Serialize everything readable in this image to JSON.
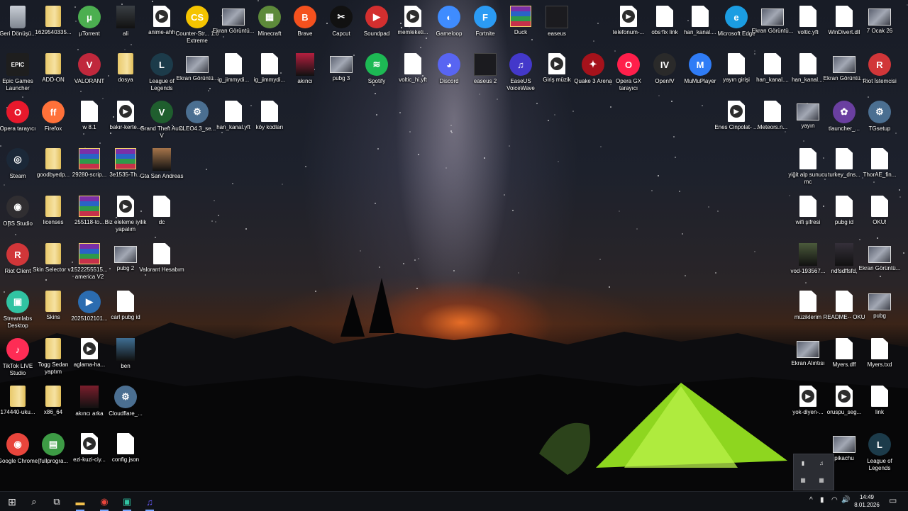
{
  "desktop": {
    "icons": [
      {
        "label": "Geri Dönüşü...",
        "kind": "bin",
        "color": "#9ca3ad"
      },
      {
        "label": "1629540335...",
        "kind": "folder"
      },
      {
        "label": "µTorrent",
        "kind": "app",
        "glyph": "μ",
        "color": "#4caf50"
      },
      {
        "label": "ali",
        "kind": "photo",
        "color": "#3a3f44"
      },
      {
        "label": "anime-ahh",
        "kind": "video"
      },
      {
        "label": "Counter-Str... 1.6 Extreme",
        "kind": "app",
        "glyph": "CS",
        "color": "#f5c400"
      },
      {
        "label": "Ekran Görüntü...",
        "kind": "image"
      },
      {
        "label": "Minecraft",
        "kind": "app",
        "glyph": "▦",
        "color": "#5d8a3a"
      },
      {
        "label": "Brave",
        "kind": "app",
        "glyph": "B",
        "color": "#f4511e"
      },
      {
        "label": "Capcut",
        "kind": "app",
        "glyph": "✂",
        "color": "#111111"
      },
      {
        "label": "Soundpad",
        "kind": "app",
        "glyph": "▶",
        "color": "#d32f2f"
      },
      {
        "label": "memleketi...",
        "kind": "video"
      },
      {
        "label": "Gameloop",
        "kind": "app",
        "glyph": "◐",
        "color": "#3f8cff"
      },
      {
        "label": "Fortnite",
        "kind": "app",
        "glyph": "F",
        "color": "#2b9bf4"
      },
      {
        "label": "Duck",
        "kind": "rar"
      },
      {
        "label": "easeus",
        "kind": "dark"
      },
      {
        "label": "telefonum-...",
        "kind": "video"
      },
      {
        "label": "obs fix link",
        "kind": "file"
      },
      {
        "label": "han_kanal....",
        "kind": "file"
      },
      {
        "label": "Microsoft Edge",
        "kind": "app",
        "glyph": "e",
        "color": "#1b9de2"
      },
      {
        "label": "Ekran Görüntü...",
        "kind": "image"
      },
      {
        "label": "voltic.yft",
        "kind": "file"
      },
      {
        "label": "WinDivert.dll",
        "kind": "file"
      },
      {
        "label": "7 Ocak 26",
        "kind": "image"
      },
      {
        "label": "Epic Games Launcher",
        "kind": "app",
        "glyph": "EPIC",
        "color": "#1e1e1e"
      },
      {
        "label": "ADD-ON",
        "kind": "folder"
      },
      {
        "label": "VALORANT",
        "kind": "app",
        "glyph": "V",
        "color": "#c0283c"
      },
      {
        "label": "dosya",
        "kind": "folder"
      },
      {
        "label": "League of Legends",
        "kind": "app",
        "glyph": "L",
        "color": "#1c3b4a"
      },
      {
        "label": "Ekran Görüntü...",
        "kind": "image"
      },
      {
        "label": "ig_jimmydi...",
        "kind": "file"
      },
      {
        "label": "ig_jimmydi...",
        "kind": "file"
      },
      {
        "label": "akıncı",
        "kind": "photo",
        "color": "#b51f3f"
      },
      {
        "label": "pubg 3",
        "kind": "image"
      },
      {
        "label": "Spotify",
        "kind": "app",
        "glyph": "≋",
        "color": "#1db954"
      },
      {
        "label": "voltic_hi.yft",
        "kind": "file"
      },
      {
        "label": "Discord",
        "kind": "app",
        "glyph": "◕",
        "color": "#5865f2"
      },
      {
        "label": "easeus 2",
        "kind": "dark"
      },
      {
        "label": "EaseUS VoiceWave",
        "kind": "app",
        "glyph": "♫",
        "color": "#4338ca"
      },
      {
        "label": "Giriş müzik",
        "kind": "video"
      },
      {
        "label": "Quake 3 Arena",
        "kind": "app",
        "glyph": "✦",
        "color": "#a5121b"
      },
      {
        "label": "Opera GX tarayıcı",
        "kind": "app",
        "glyph": "O",
        "color": "#ff1f4b"
      },
      {
        "label": "OpenIV",
        "kind": "app",
        "glyph": "IV",
        "color": "#2a2a2a"
      },
      {
        "label": "MuMuPlayer",
        "kind": "app",
        "glyph": "M",
        "color": "#2f7cf6"
      },
      {
        "label": "yayın girişi",
        "kind": "file"
      },
      {
        "label": "han_kanal....",
        "kind": "file"
      },
      {
        "label": "han_kanal....",
        "kind": "file"
      },
      {
        "label": "Ekran Görüntü...",
        "kind": "image"
      },
      {
        "label": "Riot İstemcisi",
        "kind": "app",
        "glyph": "R",
        "color": "#d13639"
      },
      {
        "label": "Opera tarayıcı",
        "kind": "app",
        "glyph": "O",
        "color": "#e8192c"
      },
      {
        "label": "Firefox",
        "kind": "app",
        "glyph": "ff",
        "color": "#ff7139"
      },
      {
        "label": "w 8.1",
        "kind": "file"
      },
      {
        "label": "bakır-kerte...",
        "kind": "video"
      },
      {
        "label": "Grand Theft Auto V",
        "kind": "app",
        "glyph": "V",
        "color": "#1f5e2e"
      },
      {
        "label": "CLEO4.3_se...",
        "kind": "app",
        "glyph": "⚙",
        "color": "#4b6f91"
      },
      {
        "label": "han_kanal.yft",
        "kind": "file"
      },
      {
        "label": "köy kodları",
        "kind": "file"
      },
      {
        "label": "Enes Cinpolat- ...",
        "kind": "video"
      },
      {
        "label": "Meteors.n...",
        "kind": "file"
      },
      {
        "label": "yayın",
        "kind": "image"
      },
      {
        "label": "tlauncher_...",
        "kind": "app",
        "glyph": "✿",
        "color": "#6a3fa0"
      },
      {
        "label": "TGsetup",
        "kind": "app",
        "glyph": "⚙",
        "color": "#4b6f91"
      },
      {
        "label": "Steam",
        "kind": "app",
        "glyph": "◎",
        "color": "#1b2838"
      },
      {
        "label": "goodbyedp...",
        "kind": "folder"
      },
      {
        "label": "29280-scrip...",
        "kind": "rar"
      },
      {
        "label": "3e1535-Th...",
        "kind": "rar"
      },
      {
        "label": "Gta San Andreas",
        "kind": "photo",
        "color": "#a5744a"
      },
      {
        "label": "yiğit alp sunucu mc",
        "kind": "file"
      },
      {
        "label": "turkey_dns...",
        "kind": "file"
      },
      {
        "label": "ThorAE_fin...",
        "kind": "file"
      },
      {
        "label": "OBS Studio",
        "kind": "app",
        "glyph": "◉",
        "color": "#302e31"
      },
      {
        "label": "licenses",
        "kind": "folder"
      },
      {
        "label": "255118-to...",
        "kind": "rar"
      },
      {
        "label": "Biz eleleme iyilik yapalım",
        "kind": "video"
      },
      {
        "label": "dc",
        "kind": "file"
      },
      {
        "label": "wifi şifresi",
        "kind": "file"
      },
      {
        "label": "pubg id",
        "kind": "file"
      },
      {
        "label": "OKU!",
        "kind": "file"
      },
      {
        "label": "Riot Client",
        "kind": "app",
        "glyph": "R",
        "color": "#d13639"
      },
      {
        "label": "Skin Selector v2",
        "kind": "folder"
      },
      {
        "label": "1522255515... america V2",
        "kind": "rar"
      },
      {
        "label": "pubg 2",
        "kind": "image"
      },
      {
        "label": "Valorant Hesabım",
        "kind": "file"
      },
      {
        "label": "vod-193567...",
        "kind": "photo",
        "color": "#4b5a3b"
      },
      {
        "label": "ndfsdffsfd,",
        "kind": "photo",
        "color": "#35303a"
      },
      {
        "label": "Ekran Görüntü...",
        "kind": "image"
      },
      {
        "label": "Streamlabs Desktop",
        "kind": "app",
        "glyph": "▣",
        "color": "#31c3a2"
      },
      {
        "label": "Skins",
        "kind": "folder"
      },
      {
        "label": "2025102101...",
        "kind": "app",
        "glyph": "▶",
        "color": "#2b6cb0"
      },
      {
        "label": "carl pubg id",
        "kind": "file"
      },
      {
        "label": "müziklerim",
        "kind": "file"
      },
      {
        "label": "README-- OKU",
        "kind": "file"
      },
      {
        "label": "pubg",
        "kind": "image"
      },
      {
        "label": "TikTok LIVE Studio",
        "kind": "app",
        "glyph": "♪",
        "color": "#fe2c55"
      },
      {
        "label": "Togg Sedan yaptım",
        "kind": "folder"
      },
      {
        "label": "aglama-ha...",
        "kind": "video"
      },
      {
        "label": "ben",
        "kind": "photo",
        "color": "#3f6e93"
      },
      {
        "label": "Ekran Alıntısı",
        "kind": "image"
      },
      {
        "label": "Myers.dff",
        "kind": "file"
      },
      {
        "label": "Myers.txd",
        "kind": "file"
      },
      {
        "label": "174440-uku...",
        "kind": "folder"
      },
      {
        "label": "x86_64",
        "kind": "folder"
      },
      {
        "label": "akıncı arka",
        "kind": "photo",
        "color": "#7a1e2c"
      },
      {
        "label": "Cloudflare_...",
        "kind": "app",
        "glyph": "⚙",
        "color": "#4b6f91"
      },
      {
        "label": "yok-diyen-...",
        "kind": "video"
      },
      {
        "label": "oruspu_seg...",
        "kind": "video"
      },
      {
        "label": "link",
        "kind": "file"
      },
      {
        "label": "Google Chrome",
        "kind": "app",
        "glyph": "◉",
        "color": "#e8453c"
      },
      {
        "label": "[fullprogra...",
        "kind": "app",
        "glyph": "▤",
        "color": "#3d9b45"
      },
      {
        "label": "ezi-kuzi-ciy...",
        "kind": "video"
      },
      {
        "label": "config.json",
        "kind": "file"
      },
      {
        "label": "pikachu",
        "kind": "image"
      },
      {
        "label": "League of Legends",
        "kind": "app",
        "glyph": "L",
        "color": "#1c3b4a"
      }
    ]
  },
  "taskbar": {
    "start_icon": "windows-start-icon",
    "search_icon": "search-icon",
    "task_view_icon": "task-view-icon",
    "apps": [
      {
        "name": "file-explorer",
        "glyph": "▬",
        "color": "#f2c04d"
      },
      {
        "name": "google-chrome",
        "glyph": "◉",
        "color": "#e8453c"
      },
      {
        "name": "streamlabs",
        "glyph": "▣",
        "color": "#31c3a2"
      },
      {
        "name": "easeus-voicewave",
        "glyph": "♫",
        "color": "#6a5cff"
      }
    ],
    "tray": {
      "overflow": "^",
      "clock_time": "14:49",
      "clock_date": "8.01.2026"
    }
  }
}
